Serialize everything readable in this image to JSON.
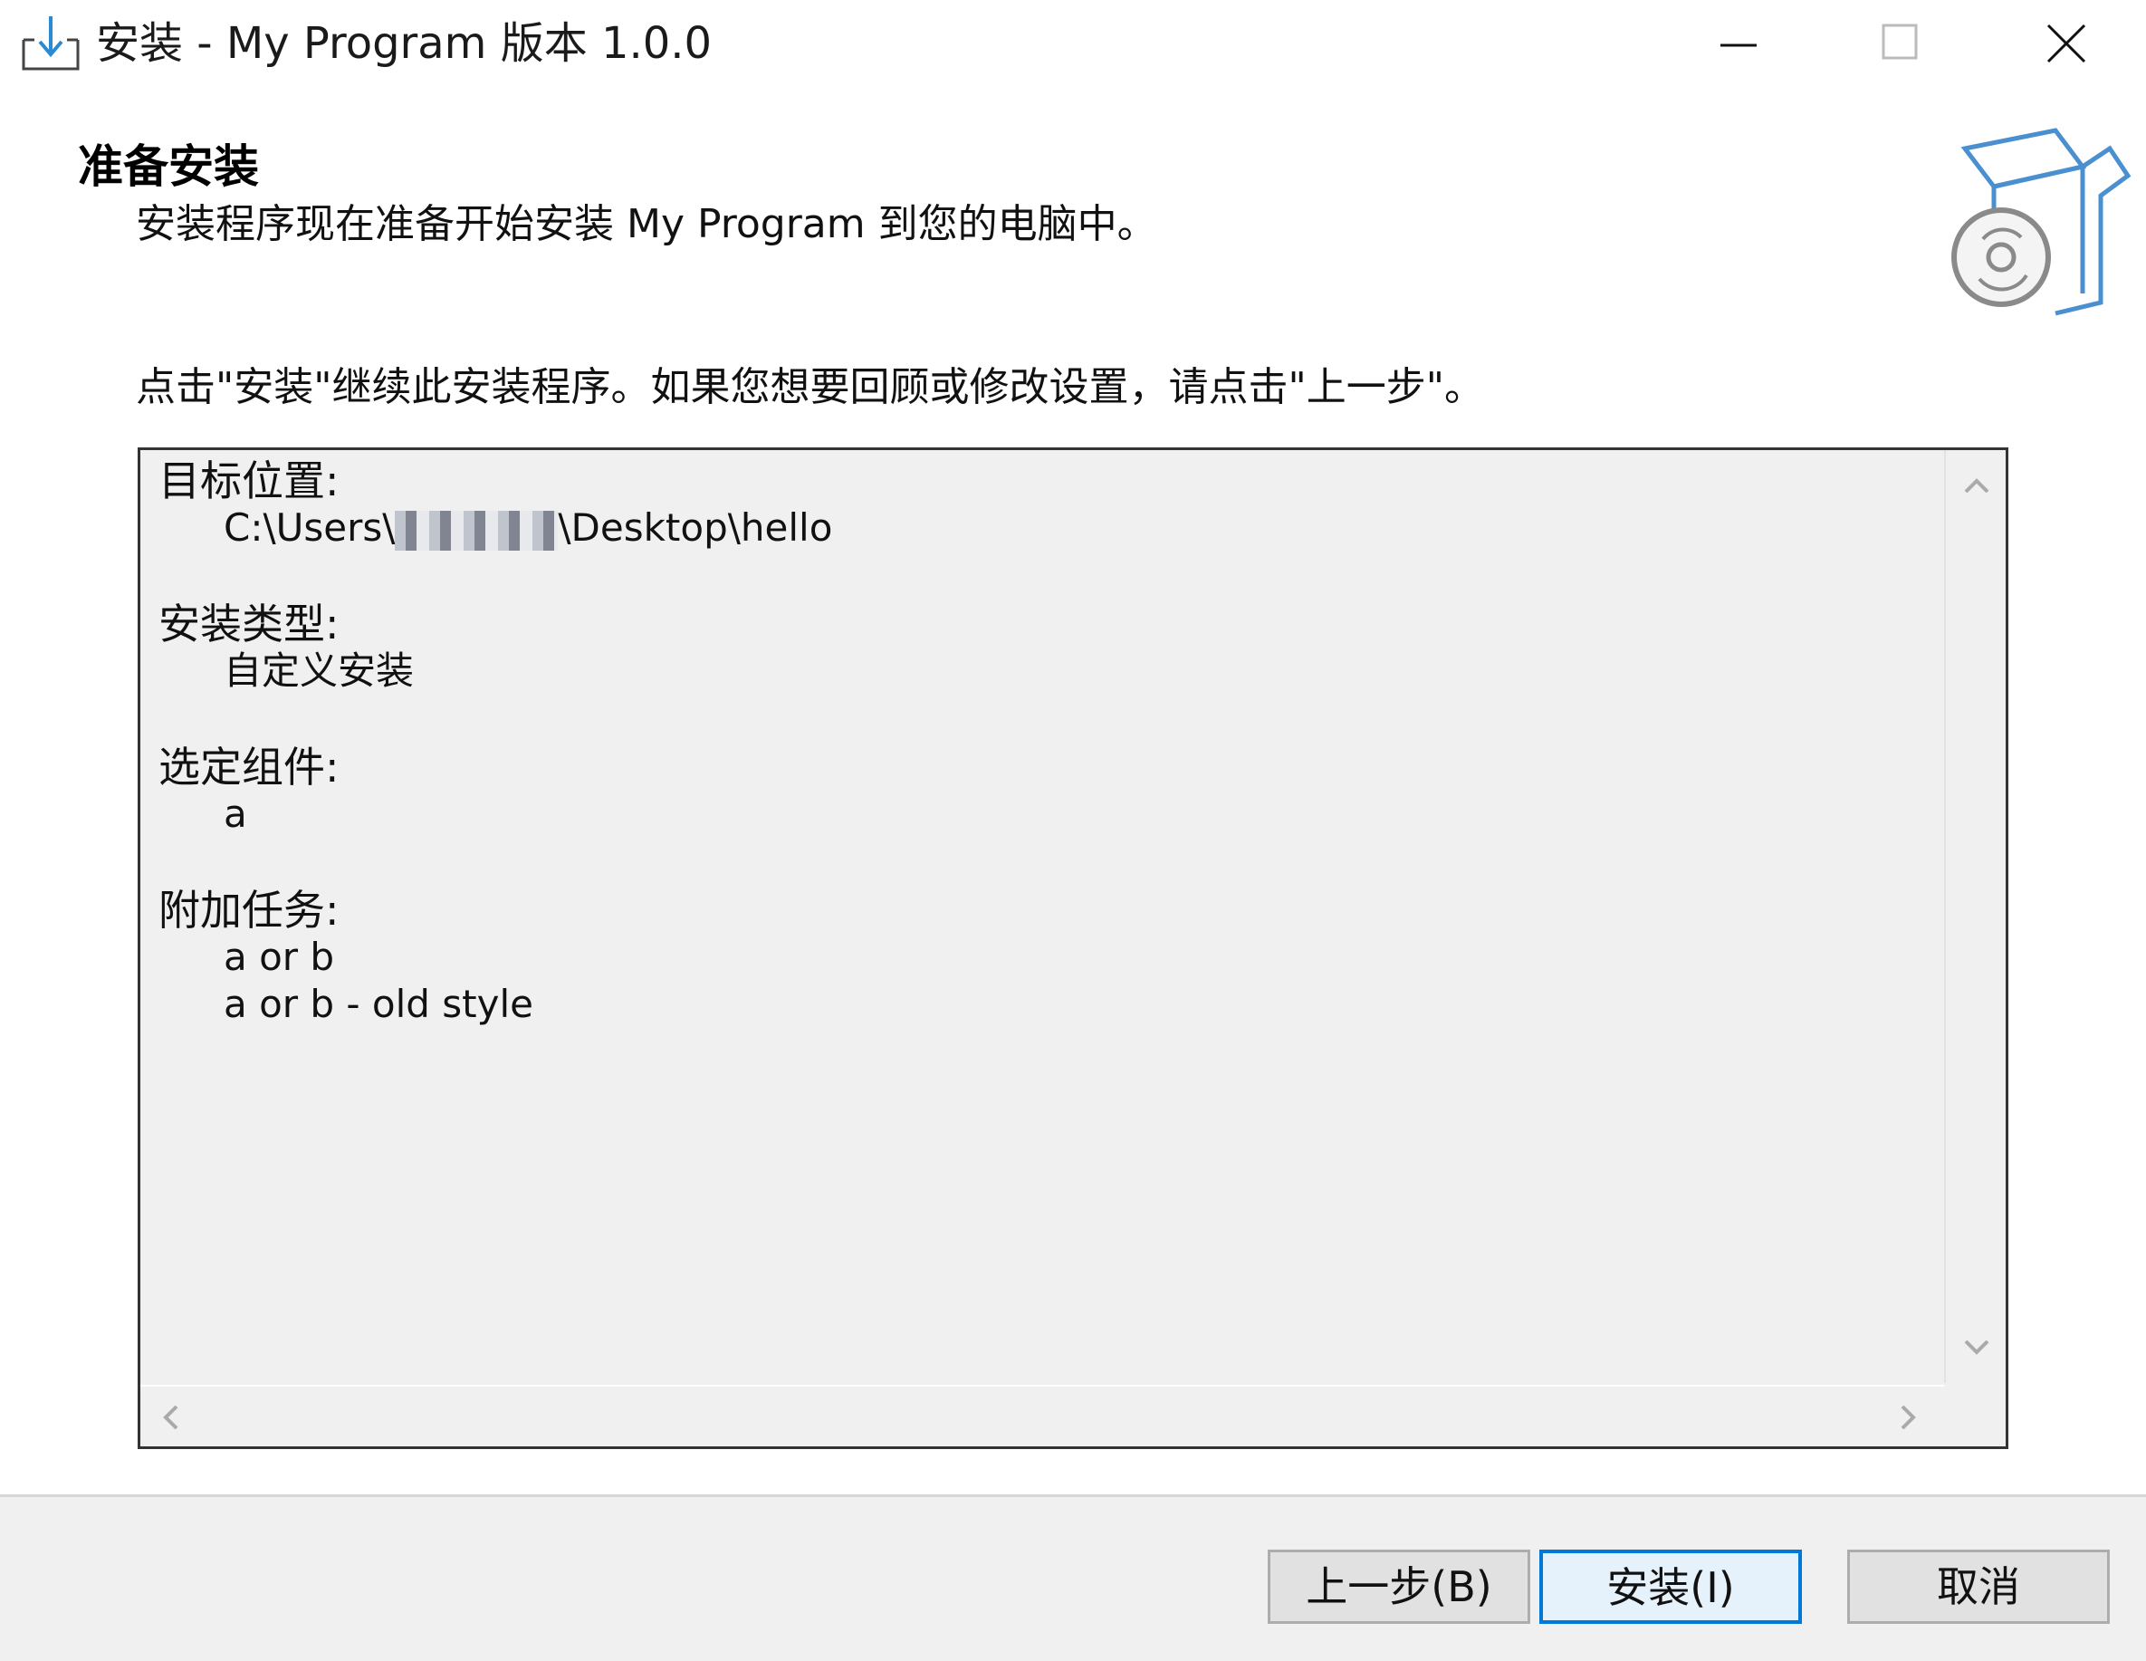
{
  "window": {
    "title": "安装 - My Program 版本 1.0.0",
    "icons": {
      "app": "installer-download-icon",
      "minimize": "minimize-icon",
      "maximize": "maximize-icon",
      "close": "close-icon"
    }
  },
  "header": {
    "title": "准备安装",
    "subtitle": "安装程序现在准备开始安装 My Program 到您的电脑中。",
    "image_icon": "setup-box-disc-icon"
  },
  "instruction": "点击\"安装\"继续此安装程序。如果您想要回顾或修改设置，请点击\"上一步\"。",
  "memo": {
    "sections": [
      {
        "heading": "目标位置:",
        "path_prefix": "C:\\Users\\",
        "path_suffix": "\\Desktop\\hello"
      },
      {
        "heading": "安装类型:",
        "items": [
          "自定义安装"
        ]
      },
      {
        "heading": "选定组件:",
        "items": [
          "a"
        ]
      },
      {
        "heading": "附加任务:",
        "items": [
          "a or b",
          "a or b - old style"
        ]
      }
    ]
  },
  "buttons": {
    "back": "上一步(B)",
    "install": "安装(I)",
    "cancel": "取消"
  },
  "colors": {
    "accent": "#0078d7",
    "panel_bg": "#f0f0f0",
    "button_bg": "#e1e1e1"
  }
}
